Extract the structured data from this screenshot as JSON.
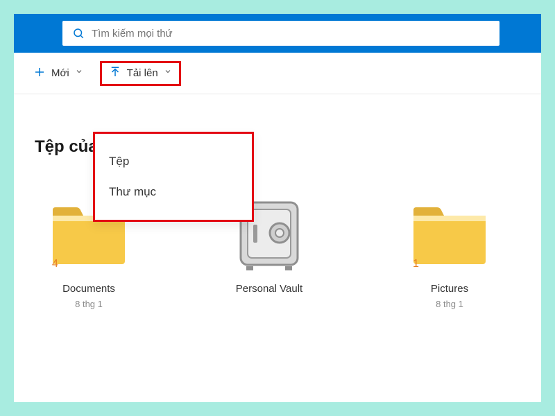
{
  "search": {
    "placeholder": "Tìm kiếm mọi thứ"
  },
  "toolbar": {
    "new_label": "Mới",
    "upload_label": "Tải lên"
  },
  "dropdown": {
    "items": [
      {
        "label": "Tệp"
      },
      {
        "label": "Thư mục"
      }
    ]
  },
  "page": {
    "title": "Tệp của"
  },
  "folders": [
    {
      "name": "Documents",
      "date": "8 thg 1",
      "count": "4",
      "type": "folder"
    },
    {
      "name": "Personal Vault",
      "date": "",
      "count": "",
      "type": "vault"
    },
    {
      "name": "Pictures",
      "date": "8 thg 1",
      "count": "1",
      "type": "folder"
    }
  ],
  "colors": {
    "brand": "#0078d4",
    "highlight": "#e30613",
    "folder_fill": "#f7c948",
    "folder_shadow": "#e2b13a"
  }
}
